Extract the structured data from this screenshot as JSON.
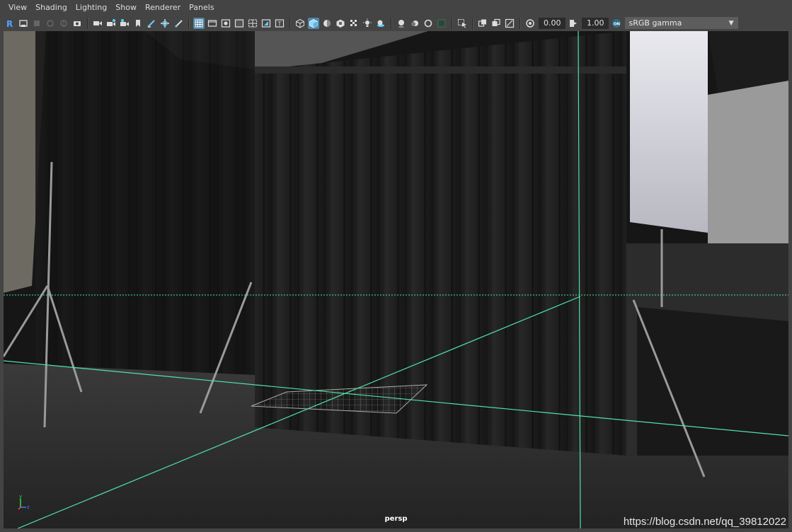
{
  "menu": [
    "View",
    "Shading",
    "Lighting",
    "Show",
    "Renderer",
    "Panels"
  ],
  "toolbar": {
    "exposure_value": "0.00",
    "gamma_value": "1.00",
    "color_space": "sRGB gamma",
    "icons": [
      "select-camera-icon",
      "camera-attributes-icon",
      "bookmark-icon",
      "image-plane-icon",
      "2d-pan-zoom-icon",
      "grease-pencil-icon",
      "snapshot-icon",
      "camera-icon",
      "lock-camera-icon",
      "camera-sequence-icon",
      "safe-frame-icon",
      "film-gate-icon",
      "resolution-gate-icon",
      "gate-mask-icon",
      "field-chart-icon",
      "safe-action-icon",
      "safe-title-icon",
      "grid-icon",
      "wireframe-icon",
      "smooth-shade-icon",
      "textured-icon",
      "lighting-icon",
      "shadows-icon",
      "screen-space-ao-icon",
      "motion-blur-icon",
      "multisample-aa-icon",
      "depth-of-field-icon",
      "isolate-select-icon",
      "xray-icon",
      "xray-joints-icon",
      "xray-active-icon",
      "exposure-icon",
      "gamma-icon",
      "color-management-icon"
    ]
  },
  "viewport": {
    "camera_name": "persp",
    "axis_labels": {
      "y": "y",
      "z": "z"
    }
  },
  "watermark": "https://blog.csdn.net/qq_39812022",
  "colors": {
    "ui_background": "#444444",
    "accent": "#5285a6",
    "grid_line": "#4fe3a6"
  }
}
